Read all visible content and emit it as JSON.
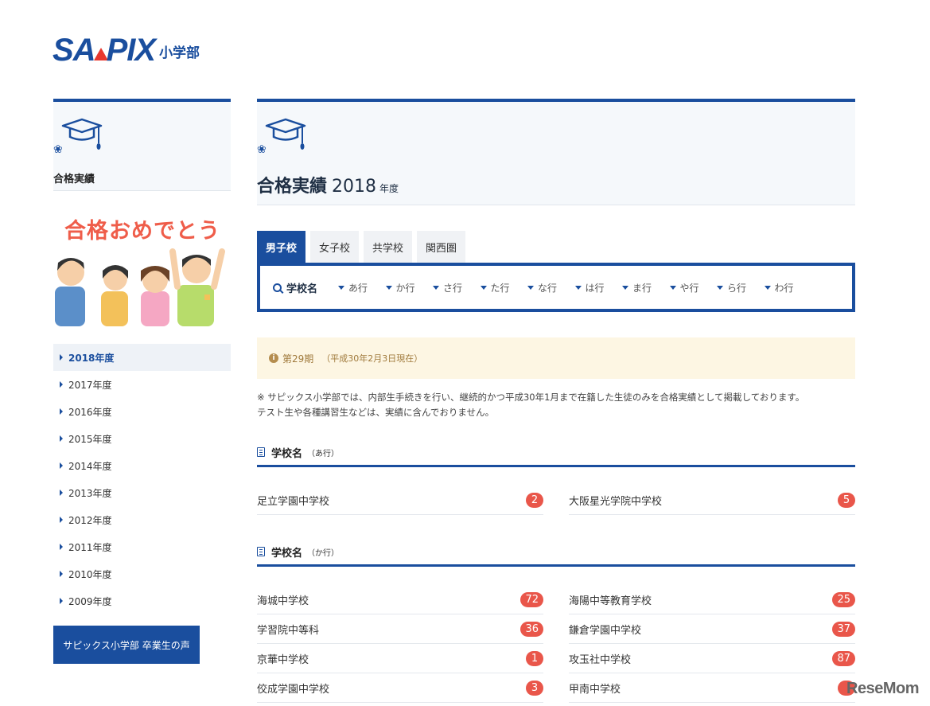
{
  "logo": {
    "word_a": "SA",
    "word_b": "PIX",
    "sub": "小学部"
  },
  "sidebar": {
    "title": "合格実績",
    "banner_text": "合格おめでとう",
    "years": [
      "2018年度",
      "2017年度",
      "2016年度",
      "2015年度",
      "2014年度",
      "2013年度",
      "2012年度",
      "2011年度",
      "2010年度",
      "2009年度"
    ],
    "graduates_button": "サピックス小学部 卒業生の声"
  },
  "main": {
    "title": "合格実績",
    "year": "2018",
    "nendo": "年度",
    "tabs": [
      "男子校",
      "女子校",
      "共学校",
      "関西圏"
    ],
    "filter_label": "学校名",
    "kana": [
      "あ行",
      "か行",
      "さ行",
      "た行",
      "な行",
      "は行",
      "ま行",
      "や行",
      "ら行",
      "わ行"
    ],
    "notice_period": "第29期",
    "notice_date": "（平成30年2月3日現在）",
    "note_line1": "※ サピックス小学部では、内部生手続きを行い、継続的かつ平成30年1月まで在籍した生徒のみを合格実績として掲載しております。",
    "note_line2": "テスト生や各種講習生などは、実績に含んでおりません。",
    "sections": [
      {
        "title": "学校名",
        "sub": "（あ行）",
        "schools": [
          {
            "name": "足立学園中学校",
            "count": "2"
          },
          {
            "name": "大阪星光学院中学校",
            "count": "5"
          }
        ]
      },
      {
        "title": "学校名",
        "sub": "（か行）",
        "schools": [
          {
            "name": "海城中学校",
            "count": "72"
          },
          {
            "name": "海陽中等教育学校",
            "count": "25"
          },
          {
            "name": "学習院中等科",
            "count": "36"
          },
          {
            "name": "鎌倉学園中学校",
            "count": "37"
          },
          {
            "name": "京華中学校",
            "count": "1"
          },
          {
            "name": "攻玉社中学校",
            "count": "87"
          },
          {
            "name": "佼成学園中学校",
            "count": "3"
          },
          {
            "name": "甲南中学校",
            "count": ""
          }
        ]
      }
    ]
  },
  "watermark": "ReseMom",
  "colors": {
    "brand": "#1a4e9e",
    "badge": "#e9564a",
    "notice_bg": "#fdf6e3"
  }
}
